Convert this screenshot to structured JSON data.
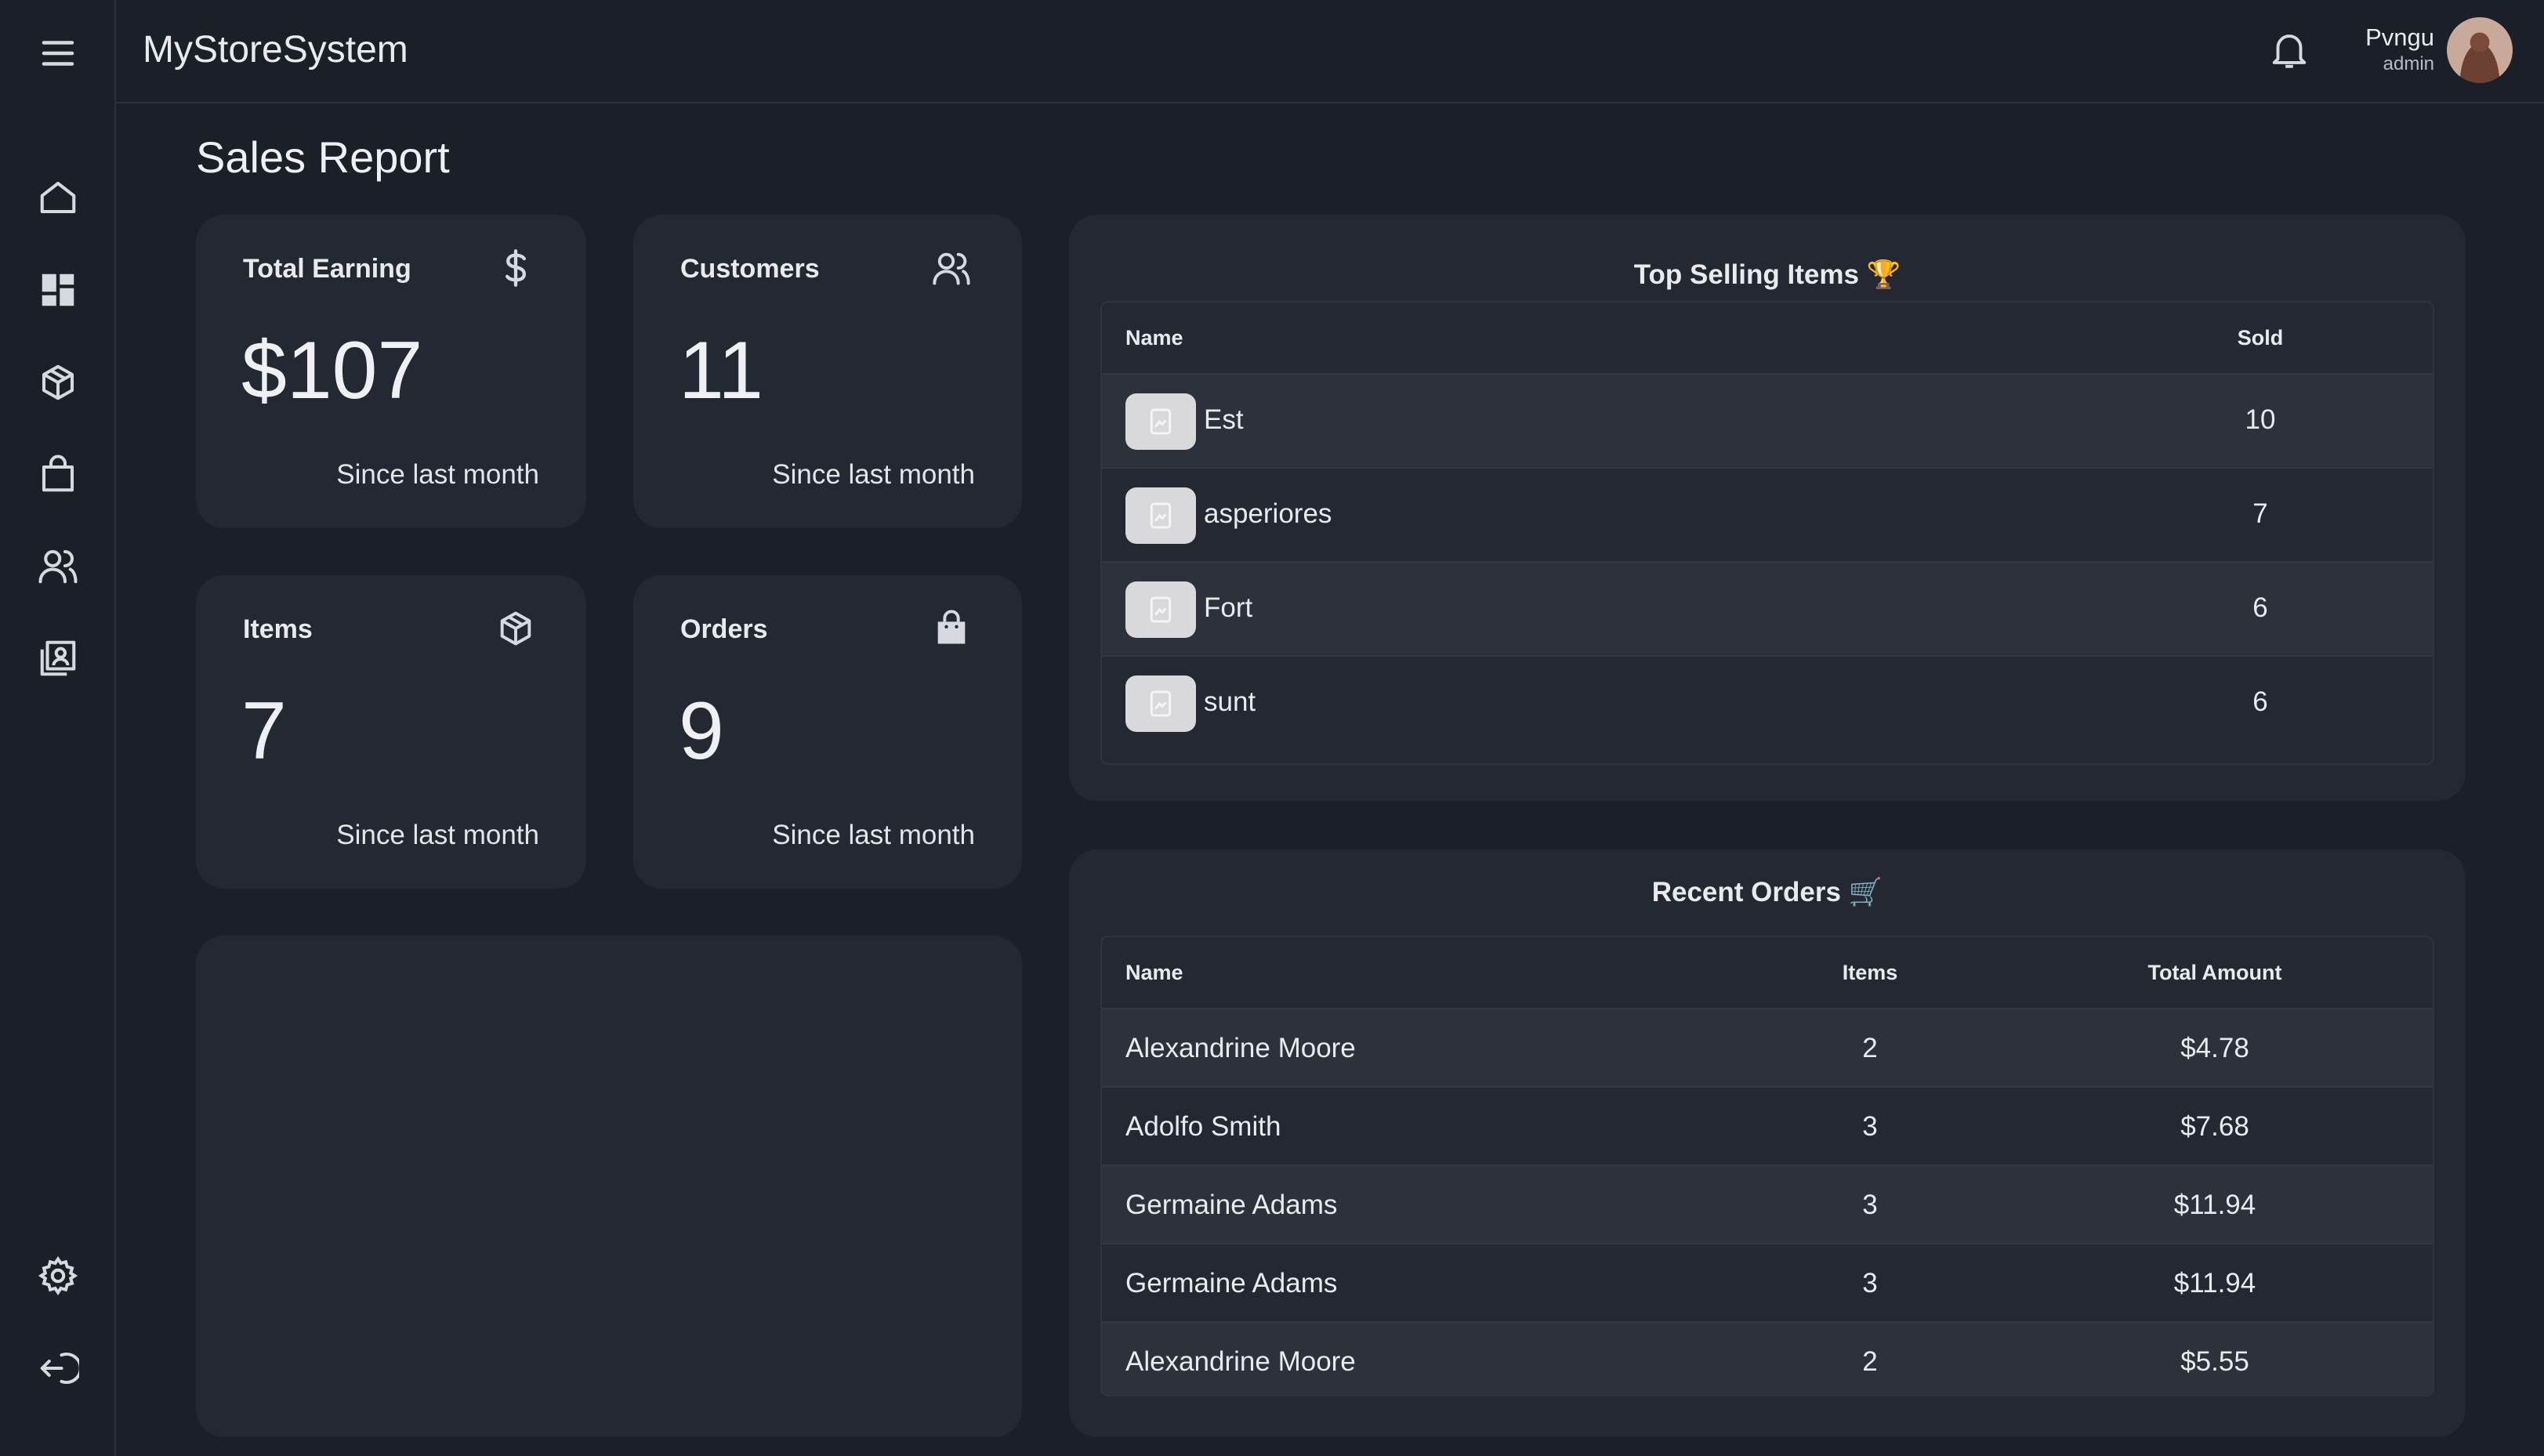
{
  "app": {
    "title": "MyStoreSystem"
  },
  "user": {
    "name": "Pvngu",
    "role": "admin"
  },
  "page": {
    "title": "Sales Report"
  },
  "sidebar": {
    "items": [
      {
        "name": "home",
        "icon": "home-icon"
      },
      {
        "name": "dashboard",
        "icon": "dashboard-grid-icon"
      },
      {
        "name": "items",
        "icon": "box-icon"
      },
      {
        "name": "orders",
        "icon": "shopping-bag-icon"
      },
      {
        "name": "customers",
        "icon": "users-icon"
      },
      {
        "name": "reports",
        "icon": "contacts-book-icon"
      }
    ],
    "bottom": [
      {
        "name": "settings",
        "icon": "gear-icon"
      },
      {
        "name": "logout",
        "icon": "logout-icon"
      }
    ]
  },
  "stats": [
    {
      "label": "Total Earning",
      "value": "$107",
      "note": "Since last month",
      "icon": "dollar-icon"
    },
    {
      "label": "Customers",
      "value": "11",
      "note": "Since last month",
      "icon": "users-icon"
    },
    {
      "label": "Items",
      "value": "7",
      "note": "Since last month",
      "icon": "box-icon"
    },
    {
      "label": "Orders",
      "value": "9",
      "note": "Since last month",
      "icon": "shopping-bag-icon"
    }
  ],
  "top_selling": {
    "title": "Top Selling Items",
    "emoji": "🏆",
    "columns": [
      "Name",
      "Sold"
    ],
    "rows": [
      {
        "name": "Est",
        "sold": "10"
      },
      {
        "name": "asperiores",
        "sold": "7"
      },
      {
        "name": "Fort",
        "sold": "6"
      },
      {
        "name": "sunt",
        "sold": "6"
      }
    ]
  },
  "recent_orders": {
    "title": "Recent Orders",
    "emoji": "🛒",
    "columns": [
      "Name",
      "Items",
      "Total Amount"
    ],
    "rows": [
      {
        "name": "Alexandrine Moore",
        "items": "2",
        "total": "$4.78"
      },
      {
        "name": "Adolfo Smith",
        "items": "3",
        "total": "$7.68"
      },
      {
        "name": "Germaine Adams",
        "items": "3",
        "total": "$11.94"
      },
      {
        "name": "Germaine Adams",
        "items": "3",
        "total": "$11.94"
      },
      {
        "name": "Alexandrine Moore",
        "items": "2",
        "total": "$5.55"
      }
    ]
  }
}
